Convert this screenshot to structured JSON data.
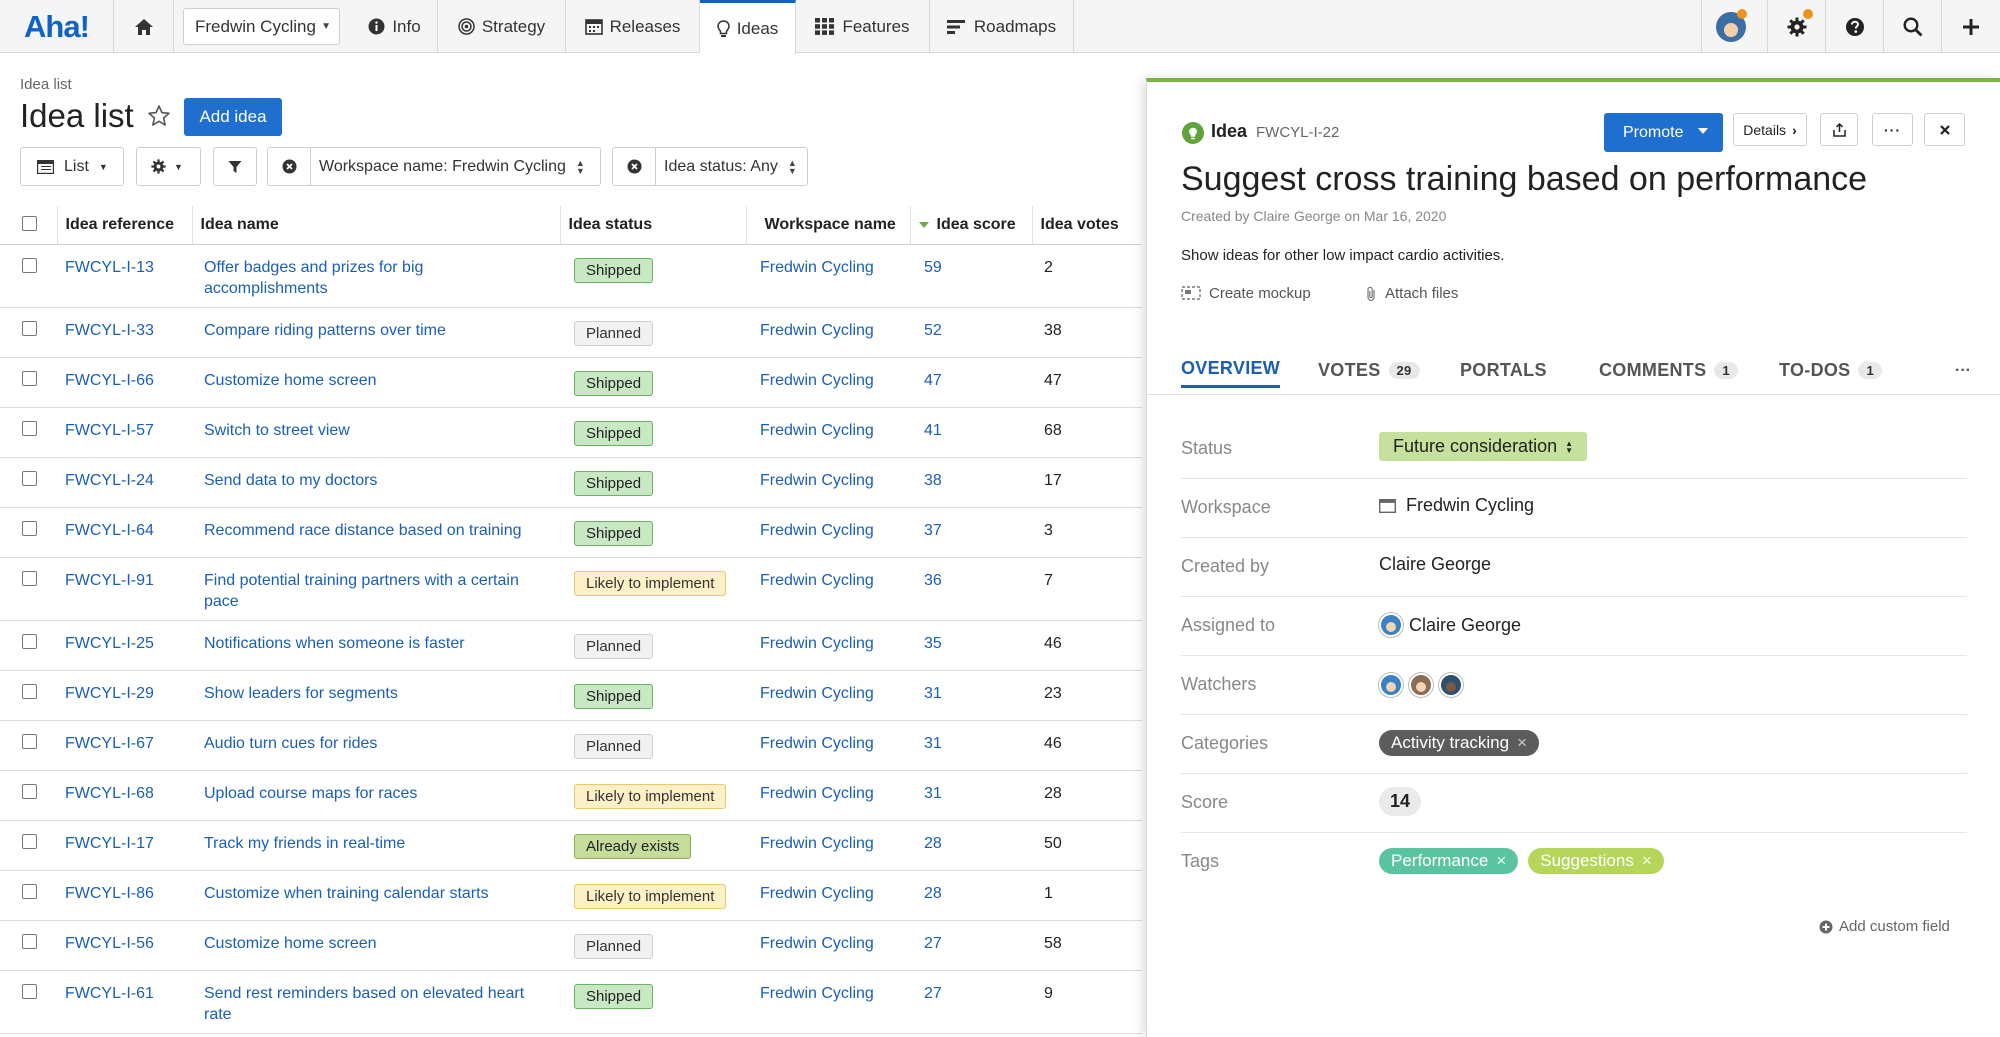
{
  "nav": {
    "logo": "Aha!",
    "workspace": "Fredwin Cycling",
    "tabs": [
      {
        "label": "Info",
        "icon": "info-icon"
      },
      {
        "label": "Strategy",
        "icon": "target-icon"
      },
      {
        "label": "Releases",
        "icon": "calendar-icon"
      },
      {
        "label": "Ideas",
        "icon": "lightbulb-icon"
      },
      {
        "label": "Features",
        "icon": "grid-icon"
      },
      {
        "label": "Roadmaps",
        "icon": "roadmap-icon"
      }
    ],
    "active_tab": "Ideas"
  },
  "list": {
    "breadcrumb": "Idea list",
    "title": "Idea list",
    "add_button": "Add idea",
    "view_button": "List",
    "filters": [
      {
        "label": "Workspace name: Fredwin Cycling"
      },
      {
        "label": "Idea status: Any"
      }
    ],
    "columns": [
      "Idea reference",
      "Idea name",
      "Idea status",
      "Workspace name",
      "Idea score",
      "Idea votes"
    ],
    "rows": [
      {
        "ref": "FWCYL-I-13",
        "name": "Offer badges and prizes for big accomplishments",
        "status": "Shipped",
        "workspace": "Fredwin Cycling",
        "score": "59",
        "votes": "2"
      },
      {
        "ref": "FWCYL-I-33",
        "name": "Compare riding patterns over time",
        "status": "Planned",
        "workspace": "Fredwin Cycling",
        "score": "52",
        "votes": "38"
      },
      {
        "ref": "FWCYL-I-66",
        "name": "Customize home screen",
        "status": "Shipped",
        "workspace": "Fredwin Cycling",
        "score": "47",
        "votes": "47"
      },
      {
        "ref": "FWCYL-I-57",
        "name": "Switch to street view",
        "status": "Shipped",
        "workspace": "Fredwin Cycling",
        "score": "41",
        "votes": "68"
      },
      {
        "ref": "FWCYL-I-24",
        "name": "Send data to my doctors",
        "status": "Shipped",
        "workspace": "Fredwin Cycling",
        "score": "38",
        "votes": "17"
      },
      {
        "ref": "FWCYL-I-64",
        "name": "Recommend race distance based on training",
        "status": "Shipped",
        "workspace": "Fredwin Cycling",
        "score": "37",
        "votes": "3"
      },
      {
        "ref": "FWCYL-I-91",
        "name": "Find potential training partners with a certain pace",
        "status": "Likely to implement",
        "workspace": "Fredwin Cycling",
        "score": "36",
        "votes": "7"
      },
      {
        "ref": "FWCYL-I-25",
        "name": "Notifications when someone is faster",
        "status": "Planned",
        "workspace": "Fredwin Cycling",
        "score": "35",
        "votes": "46"
      },
      {
        "ref": "FWCYL-I-29",
        "name": "Show leaders for segments",
        "status": "Shipped",
        "workspace": "Fredwin Cycling",
        "score": "31",
        "votes": "23"
      },
      {
        "ref": "FWCYL-I-67",
        "name": "Audio turn cues for rides",
        "status": "Planned",
        "workspace": "Fredwin Cycling",
        "score": "31",
        "votes": "46"
      },
      {
        "ref": "FWCYL-I-68",
        "name": "Upload course maps for races",
        "status": "Likely to implement",
        "workspace": "Fredwin Cycling",
        "score": "31",
        "votes": "28"
      },
      {
        "ref": "FWCYL-I-17",
        "name": "Track my friends in real-time",
        "status": "Already exists",
        "workspace": "Fredwin Cycling",
        "score": "28",
        "votes": "50"
      },
      {
        "ref": "FWCYL-I-86",
        "name": "Customize when training calendar starts",
        "status": "Likely to implement",
        "workspace": "Fredwin Cycling",
        "score": "28",
        "votes": "1"
      },
      {
        "ref": "FWCYL-I-56",
        "name": "Customize home screen",
        "status": "Planned",
        "workspace": "Fredwin Cycling",
        "score": "27",
        "votes": "58"
      },
      {
        "ref": "FWCYL-I-61",
        "name": "Send rest reminders based on elevated heart rate",
        "status": "Shipped",
        "workspace": "Fredwin Cycling",
        "score": "27",
        "votes": "9"
      }
    ]
  },
  "detail": {
    "kind": "Idea",
    "ref": "FWCYL-I-22",
    "promote_label": "Promote",
    "details_label": "Details",
    "title": "Suggest cross training based on performance",
    "created": "Created by Claire George on Mar 16, 2020",
    "description": "Show ideas for other low impact cardio activities.",
    "create_mockup": "Create mockup",
    "attach_files": "Attach files",
    "tabs": [
      {
        "label": "OVERVIEW",
        "count": ""
      },
      {
        "label": "VOTES",
        "count": "29"
      },
      {
        "label": "PORTALS",
        "count": ""
      },
      {
        "label": "COMMENTS",
        "count": "1"
      },
      {
        "label": "TO-DOS",
        "count": "1"
      }
    ],
    "fields": {
      "status_label": "Status",
      "status_value": "Future consideration",
      "workspace_label": "Workspace",
      "workspace_value": "Fredwin Cycling",
      "created_by_label": "Created by",
      "created_by_value": "Claire George",
      "assigned_label": "Assigned to",
      "assigned_value": "Claire George",
      "watchers_label": "Watchers",
      "categories_label": "Categories",
      "category_value": "Activity tracking",
      "score_label": "Score",
      "score_value": "14",
      "tags_label": "Tags",
      "tag1": "Performance",
      "tag2": "Suggestions"
    },
    "add_custom_field": "Add custom field"
  },
  "colors": {
    "brand": "#0f62c7",
    "shipped": "#c8e8c3",
    "planned": "#f1f1f1",
    "likely": "#fdf0c7",
    "already": "#c5dc9b",
    "status_future": "#c6e19b",
    "tag_performance": "#5ac4a0",
    "tag_suggestions": "#b5d65a",
    "category": "#5c5c5c"
  }
}
